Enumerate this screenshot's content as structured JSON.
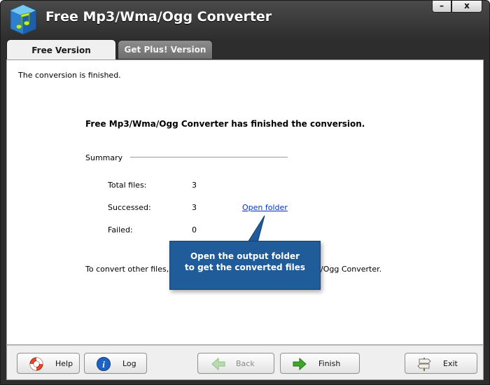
{
  "window": {
    "title": "Free Mp3/Wma/Ogg Converter",
    "controls": {
      "minimize": "–",
      "close": "x"
    }
  },
  "tabs": [
    {
      "label": "Free Version",
      "active": true
    },
    {
      "label": "Get Plus! Version",
      "active": false
    }
  ],
  "panel": {
    "status": "The conversion is finished.",
    "heading": "Free Mp3/Wma/Ogg Converter has finished the conversion.",
    "summary_label": "Summary",
    "rows": [
      {
        "label": "Total files:",
        "value": "3"
      },
      {
        "label": "Successed:",
        "value": "3"
      },
      {
        "label": "Failed:",
        "value": "0"
      }
    ],
    "open_folder_link": "Open folder",
    "convert_prefix": "To convert other files, cli",
    "convert_suffix": "/Ogg Converter."
  },
  "callout": {
    "line1": "Open the output folder",
    "line2": "to get the converted files",
    "color": "#1f5c99"
  },
  "buttons": {
    "help": {
      "label": "Help",
      "icon": "lifebuoy-icon"
    },
    "log": {
      "label": "Log",
      "icon": "info-icon"
    },
    "back": {
      "label": "Back",
      "icon": "arrow-left-icon",
      "enabled": false
    },
    "finish": {
      "label": "Finish",
      "icon": "arrow-right-icon"
    },
    "exit": {
      "label": "Exit",
      "icon": "signpost-icon"
    }
  }
}
